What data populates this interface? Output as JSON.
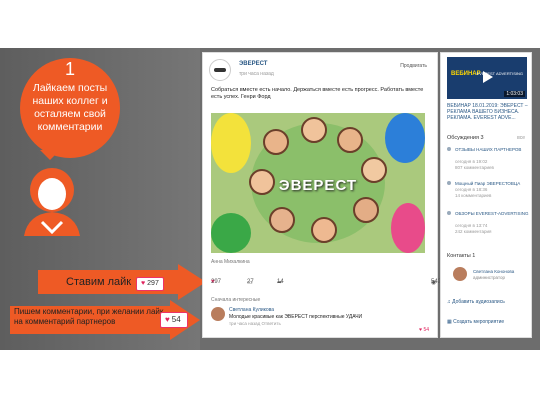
{
  "bubble": {
    "number": "1",
    "text": "Лайкаем посты наших коллег и осталяем свой комментарии"
  },
  "arrows": {
    "like_label": "Ставим лайк",
    "like_count": "297",
    "comment_label": "Пишем комментарии, при желании лайк на комментарий партнеров",
    "comment_like_count": "54"
  },
  "post": {
    "author": "ЭВЕРЕСТ",
    "time": "три часа назад",
    "promote": "Продвигать",
    "text": "Собраться вместе есть начало. Держаться вместе есть прогресс. Работать вместе есть успех. Генри Форд",
    "photo_title": "ЭВЕРЕСТ",
    "photo_author": "Анна Михалкина",
    "likes": "297",
    "comments": "27",
    "shares": "14",
    "views": "542",
    "comments_header": "Сначала интересные",
    "comment": {
      "name": "Светлана Куликова",
      "text": "Молодые красивые как ЭВЕРЕСТ перспективные УДАЧИ",
      "time": "три часа назад  Ответить",
      "likes": "54"
    }
  },
  "side": {
    "video_text": "ВЕБИНАР",
    "video_date": "18.01.2019",
    "video_tag": "EVEREST ADVERTISING",
    "video_duration": "1:03:03",
    "title": "ВЕБИНАР 18.01.2019: ЭВЕРЕСТ – РЕКЛАМА ВАШЕГО БИЗНЕСА. РЕКЛАМА. EVEREST ADVE...",
    "discussions_header": "Обсуждения 3",
    "discussions_all": "все",
    "discussions": [
      {
        "title": "ОТЗЫВЫ НАШИХ ПАРТНЕРОВ",
        "meta": "сегодня в 19:02",
        "count": "807 комментариев"
      },
      {
        "title": "Мощный Пиар ЭВЕРЕСТОВЦА",
        "meta": "сегодня в 18:36",
        "count": "14 комментариев"
      },
      {
        "title": "ОБЗОРЫ EVEREST-ADVERTISING",
        "meta": "сегодня в 13:74",
        "count": "242 комментария"
      }
    ],
    "contacts_header": "Контакты 1",
    "contact_name": "Светлана Кононова",
    "contact_role": "администратор",
    "add_audio": "Добавить аудиозапись",
    "create_event": "Создать мероприятие"
  }
}
